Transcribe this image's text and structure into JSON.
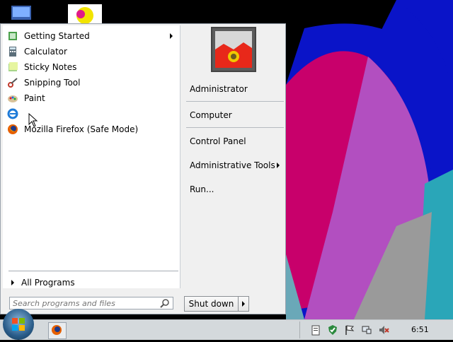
{
  "desktop": {
    "wallpaper_colors": [
      "#000000",
      "#0a14c8",
      "#e0187e",
      "#b83ec4",
      "#2aa6b8",
      "#9a9a9a",
      "#c10057"
    ]
  },
  "start_menu": {
    "programs": [
      {
        "label": "Getting Started",
        "icon": "getting-started-icon",
        "has_submenu": true
      },
      {
        "label": "Calculator",
        "icon": "calculator-icon",
        "has_submenu": false
      },
      {
        "label": "Sticky Notes",
        "icon": "sticky-notes-icon",
        "has_submenu": false
      },
      {
        "label": "Snipping Tool",
        "icon": "snipping-tool-icon",
        "has_submenu": false
      },
      {
        "label": "Paint",
        "icon": "paint-icon",
        "has_submenu": false
      },
      {
        "label": "",
        "icon": "internet-explorer-icon",
        "has_submenu": false
      },
      {
        "label": "Mozilla Firefox (Safe Mode)",
        "icon": "firefox-icon",
        "has_submenu": false
      }
    ],
    "all_programs_label": "All Programs",
    "search_placeholder": "Search programs and files",
    "right_items": {
      "user": "Administrator",
      "computer": "Computer",
      "control_panel": "Control Panel",
      "admin_tools": "Administrative Tools",
      "run": "Run..."
    },
    "shutdown_label": "Shut down"
  },
  "taskbar": {
    "clock": "6:51"
  }
}
